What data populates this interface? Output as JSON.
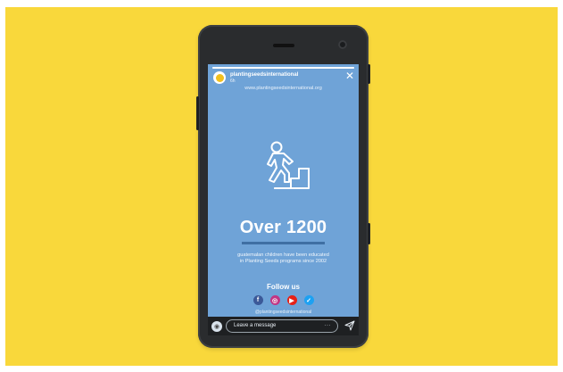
{
  "story": {
    "account_name": "plantingseedsinternational",
    "time_ago": "6h",
    "url": "www.plantingseedsinternational.org",
    "progress": 1.0,
    "headline": "Over 1200",
    "description": "guatemalan children have been educated in Planting Seeds programs since 2002",
    "follow_label": "Follow us",
    "social": [
      {
        "name": "facebook-icon",
        "glyph": "f",
        "color": "#3b5998"
      },
      {
        "name": "instagram-icon",
        "glyph": "◎",
        "color": "#c13584"
      },
      {
        "name": "youtube-icon",
        "glyph": "▶",
        "color": "#e62117"
      },
      {
        "name": "twitter-icon",
        "glyph": "✓",
        "color": "#1da1f2"
      }
    ],
    "handle": "@plantingseedsinternational"
  },
  "footer": {
    "message_placeholder": "Leave a message",
    "more_label": "···"
  },
  "colors": {
    "background": "#f9d83b",
    "story_bg": "#6fa3d7",
    "rule": "#3f6fa3"
  },
  "icons": {
    "close": "close-icon",
    "stairs": "person-climbing-stairs-icon",
    "camera": "camera-icon",
    "send": "send-icon"
  }
}
